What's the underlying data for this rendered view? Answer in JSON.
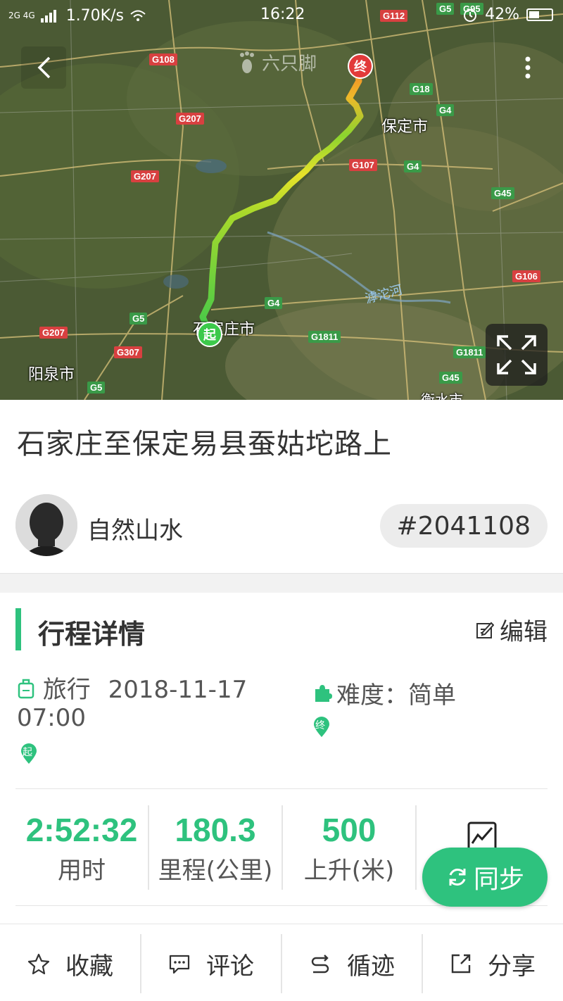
{
  "status_bar": {
    "network": "2G 4G",
    "speed": "1.70K/s",
    "time": "16:22",
    "battery": "42%"
  },
  "map": {
    "watermark": "六只脚",
    "cities": [
      "保定市",
      "石家庄市",
      "阳泉市",
      "衡水市"
    ],
    "river": "滹沱河",
    "roads": [
      "G112",
      "G5",
      "G95",
      "G108",
      "G18",
      "G4",
      "G207",
      "G107",
      "G45",
      "G106",
      "G1811",
      "G307",
      "G207",
      "G307",
      "G5",
      "G4"
    ],
    "marker_start": "起",
    "marker_end": "终"
  },
  "trip": {
    "title": "石家庄至保定易县蚕姑坨路上",
    "author": "自然山水",
    "id": "#2041108"
  },
  "details": {
    "section_title": "行程详情",
    "edit_label": "编辑",
    "type": "旅行",
    "datetime": "2018-11-17 07:00",
    "difficulty": "难度：简单",
    "pin_start": "起",
    "pin_end": "终"
  },
  "stats": [
    {
      "value": "2:52:32",
      "label": "用时"
    },
    {
      "value": "180.3",
      "label": "里程(公里)"
    },
    {
      "value": "500",
      "label": "上升(米)"
    }
  ],
  "sync_label": "同步",
  "actions": [
    {
      "label": "收藏",
      "icon": "star-icon"
    },
    {
      "label": "评论",
      "icon": "comment-icon"
    },
    {
      "label": "循迹",
      "icon": "track-icon"
    },
    {
      "label": "分享",
      "icon": "share-icon"
    }
  ],
  "colors": {
    "accent": "#2ec27e",
    "route_start": "#3cc94a",
    "route_end": "#e23a3a"
  }
}
